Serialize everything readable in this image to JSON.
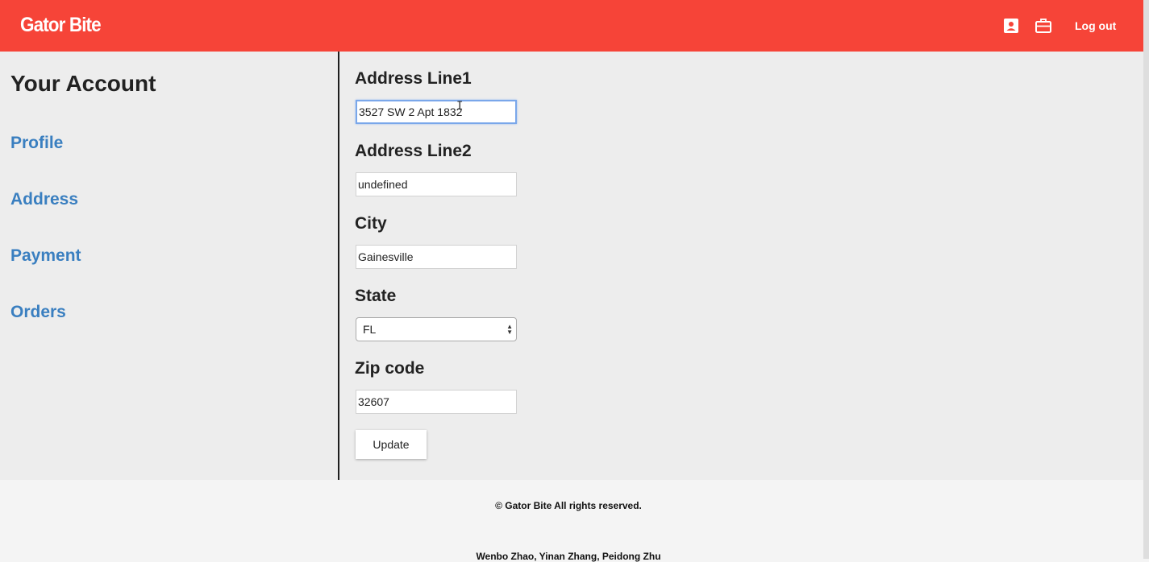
{
  "header": {
    "brand": "Gator Bite",
    "account_icon": "account-box-icon",
    "briefcase_icon": "briefcase-icon",
    "logout_label": "Log out",
    "color": "#f64438"
  },
  "sidebar": {
    "title": "Your Account",
    "items": [
      {
        "label": "Profile"
      },
      {
        "label": "Address"
      },
      {
        "label": "Payment"
      },
      {
        "label": "Orders"
      }
    ],
    "link_color": "#3a7fc0"
  },
  "form": {
    "address_line1": {
      "label": "Address Line1",
      "value": "3527 SW 2 Apt 1832"
    },
    "address_line2": {
      "label": "Address Line2",
      "value": "undefined"
    },
    "city": {
      "label": "City",
      "value": "Gainesville"
    },
    "state": {
      "label": "State",
      "value": "FL"
    },
    "zip": {
      "label": "Zip code",
      "value": "32607"
    },
    "update_label": "Update"
  },
  "footer": {
    "copyright": "© Gator Bite All rights reserved.",
    "authors": "Wenbo Zhao, Yinan Zhang, Peidong Zhu"
  }
}
